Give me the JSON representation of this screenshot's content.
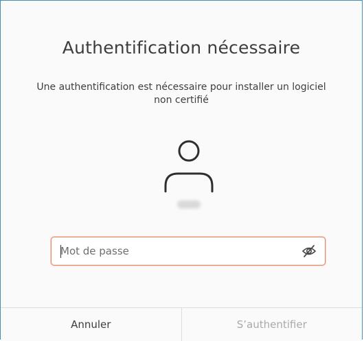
{
  "dialog": {
    "title": "Authentification nécessaire",
    "message": "Une authentification est nécessaire pour installer un logiciel non certifié",
    "password": {
      "placeholder": "Mot de passe",
      "value": ""
    },
    "cancel_label": "Annuler",
    "authenticate_label": "S’authentifier"
  },
  "icons": {
    "avatar": "user-icon",
    "visibility": "eye-slash-icon"
  },
  "colors": {
    "window_border": "#3f8fb5",
    "focus_border": "#e08b6a",
    "text": "#3d3d3d",
    "disabled_text": "#a9a9a9"
  }
}
